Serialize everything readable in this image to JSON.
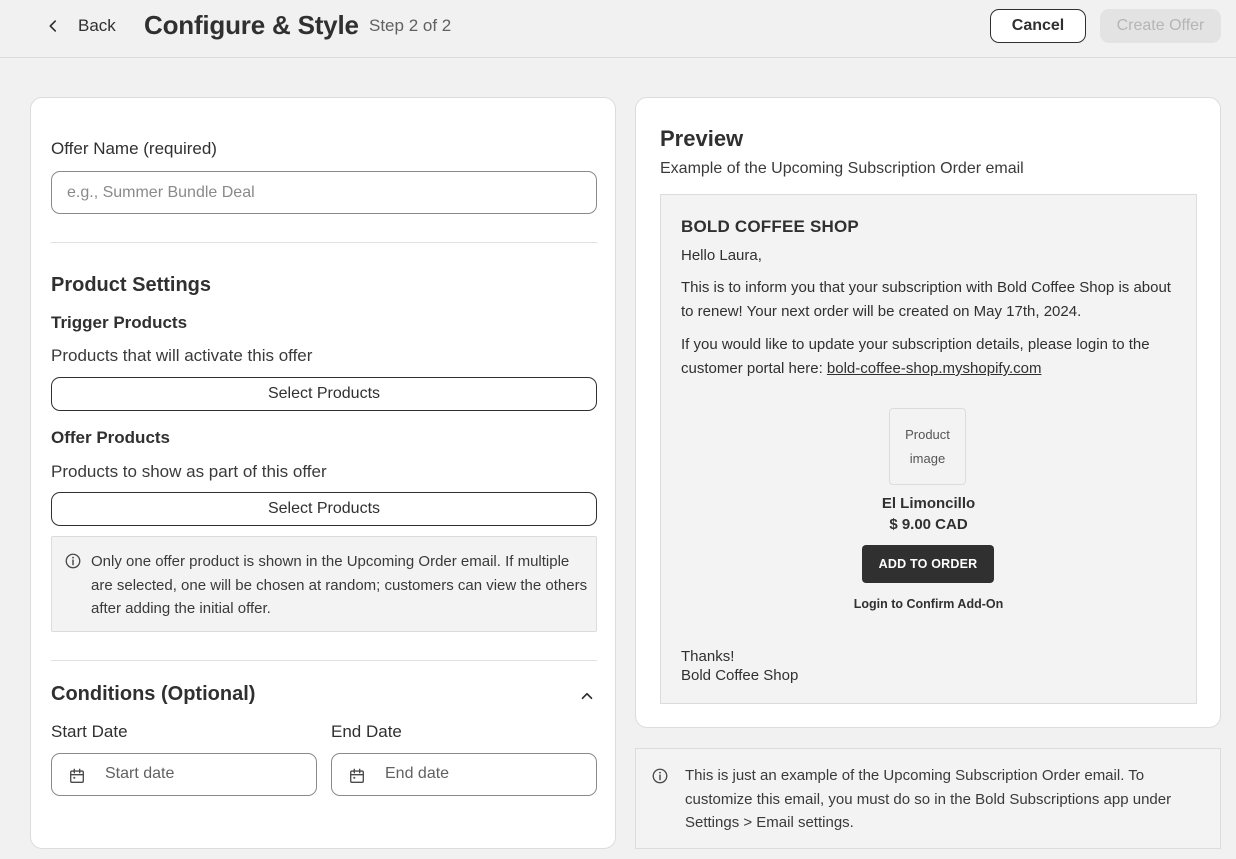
{
  "header": {
    "back_label": "Back",
    "title": "Configure & Style",
    "step": "Step 2 of 2",
    "cancel_label": "Cancel",
    "create_label": "Create Offer"
  },
  "form": {
    "offer_name_label": "Offer Name (required)",
    "offer_name_placeholder": "e.g., Summer Bundle Deal",
    "product_settings_title": "Product Settings",
    "trigger_title": "Trigger Products",
    "trigger_help": "Products that will activate this offer",
    "trigger_button": "Select Products",
    "offer_products_title": "Offer Products",
    "offer_products_help": "Products to show as part of this offer",
    "offer_products_button": "Select Products",
    "info_note": "Only one offer product is shown in the Upcoming Order email. If multiple are selected, one will be chosen at random; customers can view the others after adding the initial offer.",
    "conditions_title": "Conditions (Optional)",
    "start_date_label": "Start Date",
    "start_date_placeholder": "Start date",
    "end_date_label": "End Date",
    "end_date_placeholder": "End date"
  },
  "preview": {
    "title": "Preview",
    "subtitle": "Example of the Upcoming Subscription Order email",
    "email": {
      "shop_name": "BOLD COFFEE SHOP",
      "greeting": "Hello Laura,",
      "paragraph1": "This is to inform you that your subscription with Bold Coffee Shop is about to renew! Your next order will be created on May 17th, 2024.",
      "paragraph2_prefix": "If you would like to update your subscription details, please login to the customer portal here: ",
      "portal_link": "bold-coffee-shop.myshopify.com",
      "product_image_placeholder": "Product image",
      "product_name": "El Limoncillo",
      "product_price": "$ 9.00 CAD",
      "add_button": "ADD TO ORDER",
      "login_confirm": "Login to Confirm Add-On",
      "thanks": "Thanks!",
      "signature": "Bold Coffee Shop"
    },
    "bottom_note": "This is just an example of the Upcoming Subscription Order email. To customize this email, you must do so in the Bold Subscriptions app under Settings > Email settings."
  }
}
